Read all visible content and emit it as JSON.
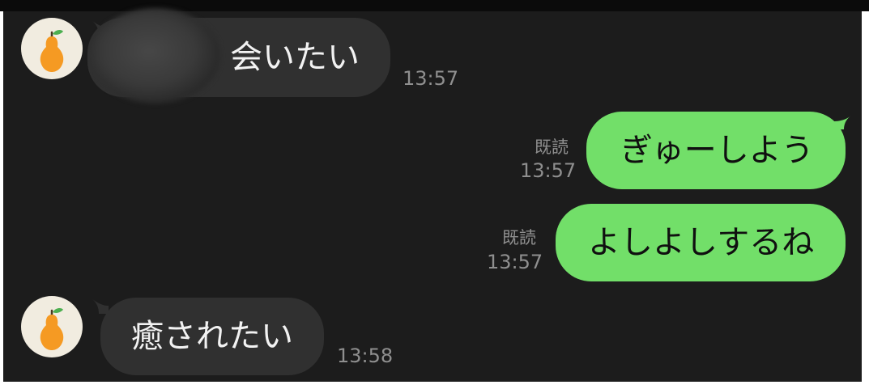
{
  "chat": {
    "messages": [
      {
        "side": "incoming",
        "text": "会いたい",
        "time": "13:57"
      },
      {
        "side": "outgoing",
        "read": "既読",
        "text": "ぎゅーしよう",
        "time": "13:57"
      },
      {
        "side": "outgoing",
        "read": "既読",
        "text": "よしよしするね",
        "time": "13:57"
      },
      {
        "side": "incoming",
        "text": "癒されたい",
        "time": "13:58"
      }
    ]
  },
  "colors": {
    "background": "#1c1c1c",
    "incoming_bubble": "#303030",
    "outgoing_bubble": "#72df69",
    "timestamp": "#8f8f8f",
    "pear": "#f59a23",
    "avatar_bg": "#f1ece0"
  },
  "icons": {
    "avatar": "pear-icon"
  }
}
